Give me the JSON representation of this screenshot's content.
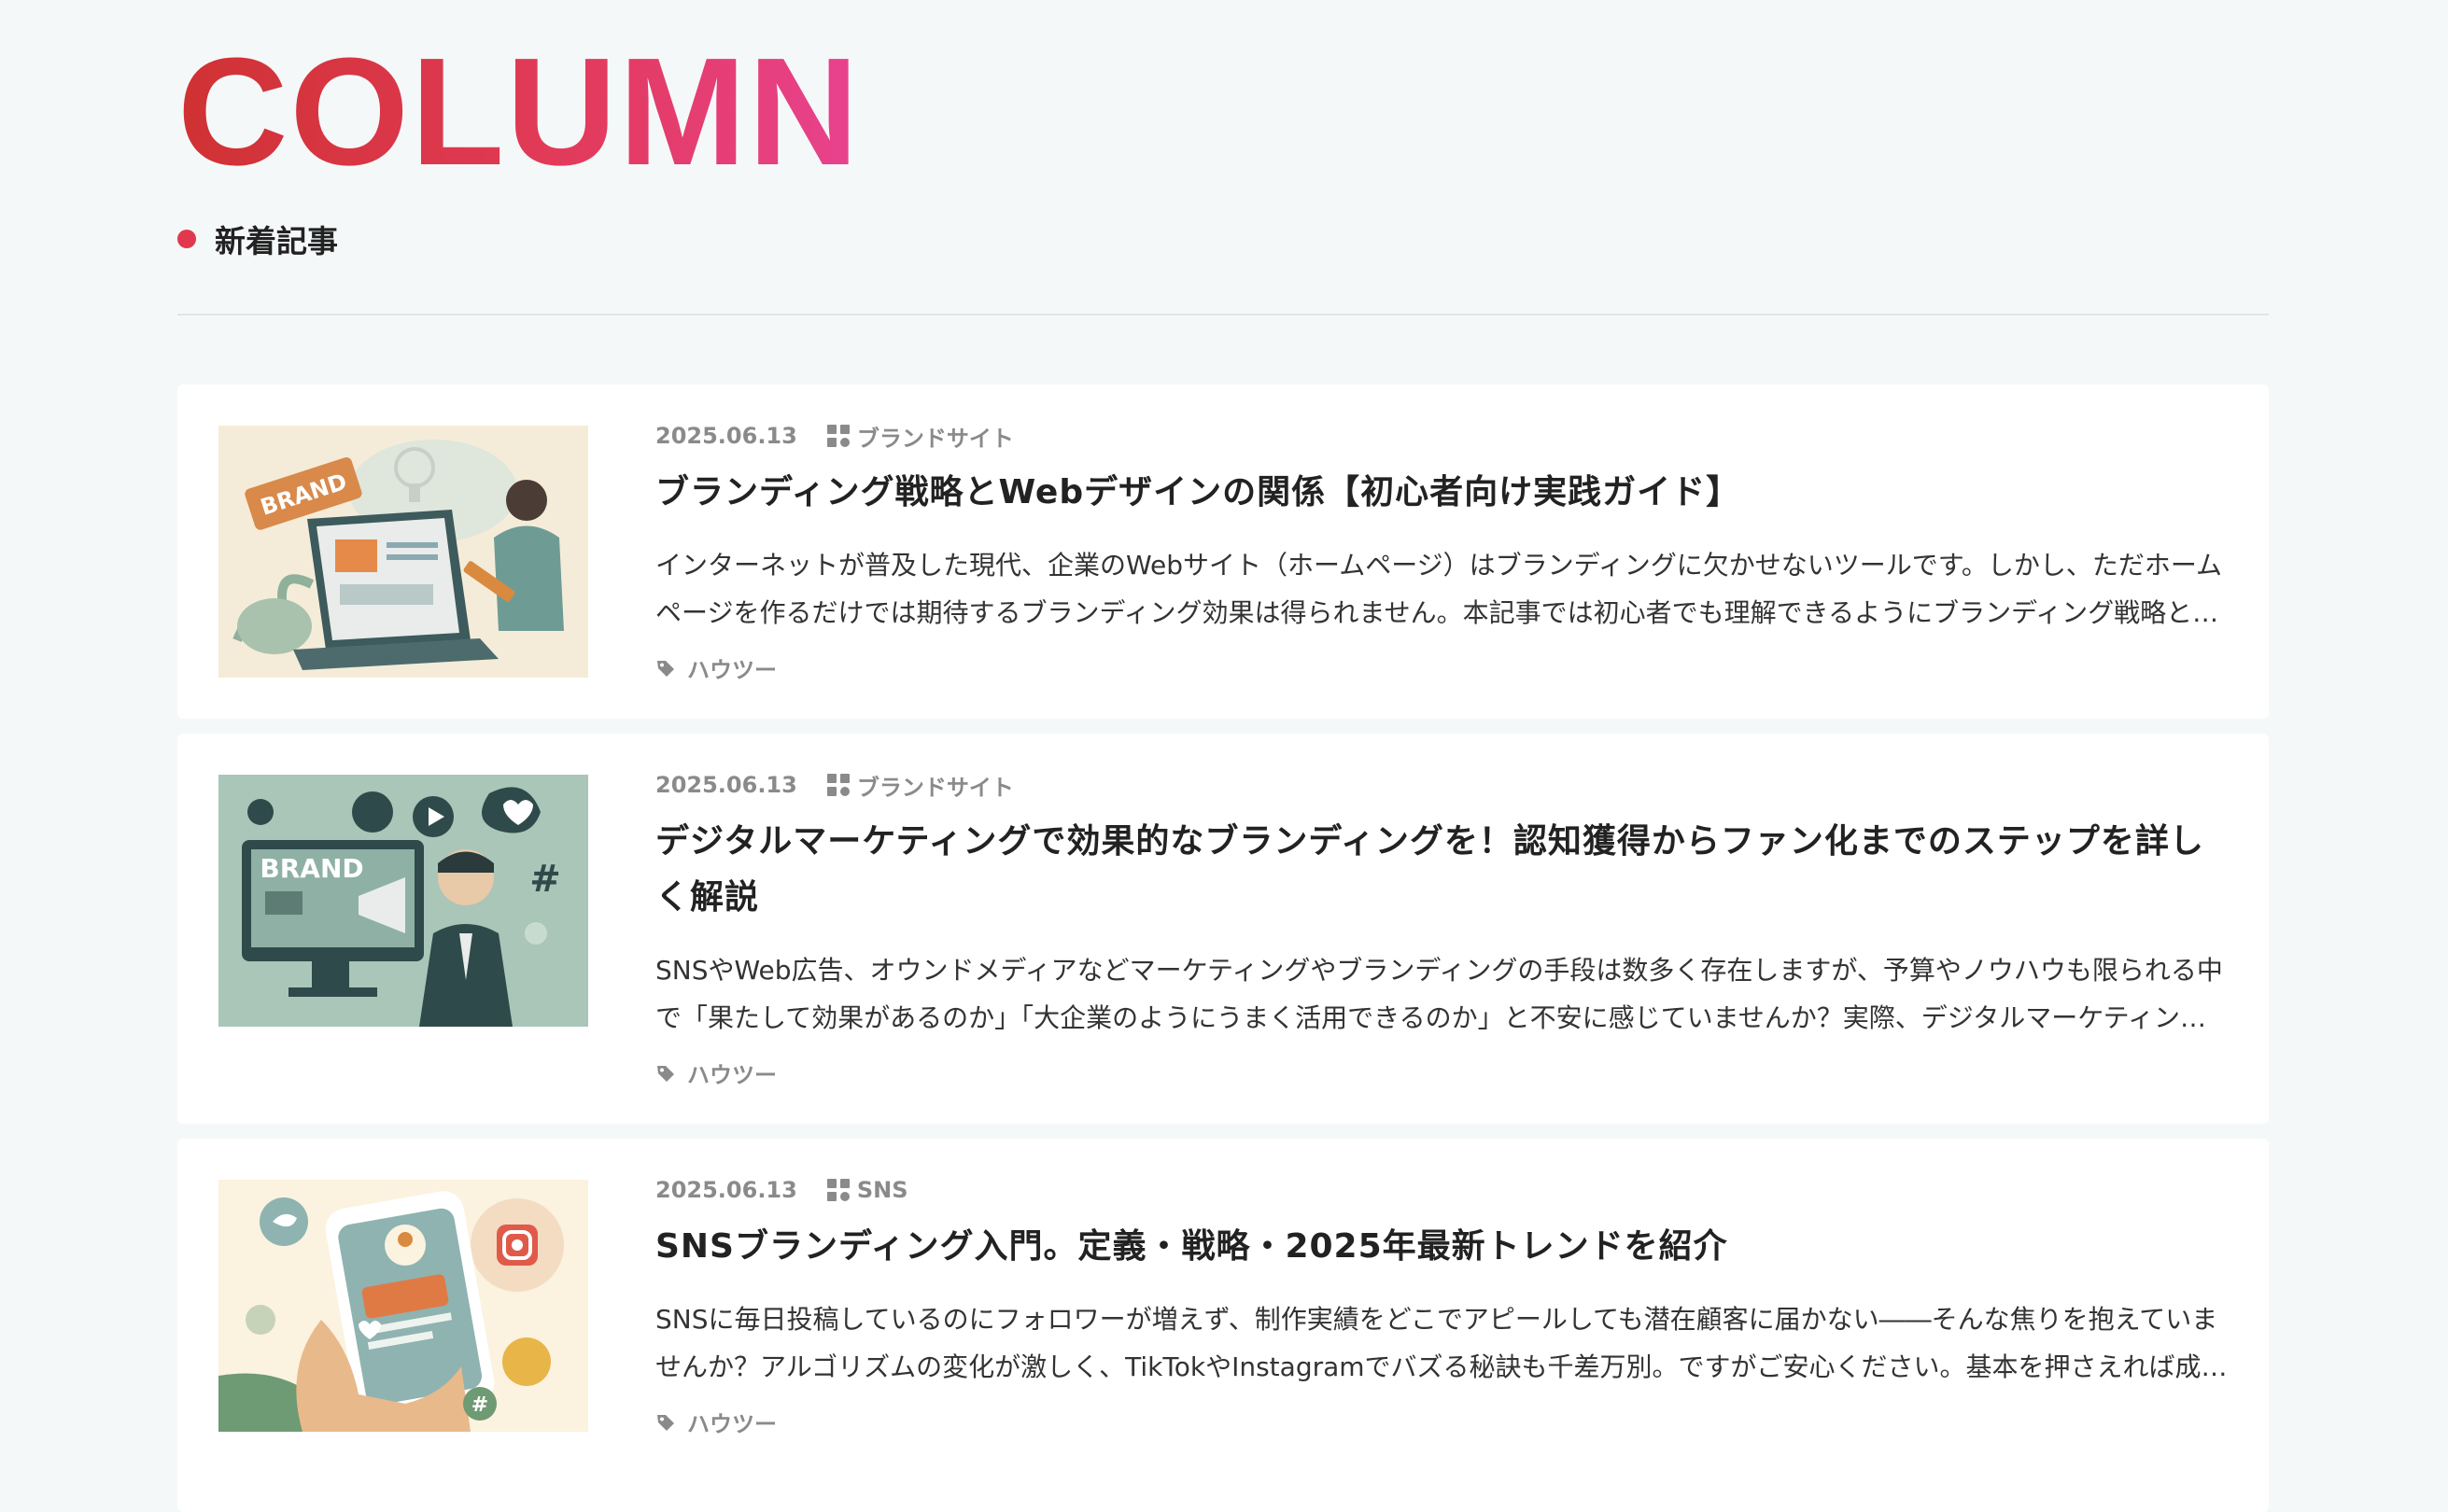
{
  "header": {
    "title": "COLUMN",
    "subtitle": "新着記事"
  },
  "colors": {
    "accent_dot": "#e2384d",
    "title_gradient_start": "#cf3233",
    "title_gradient_end": "#e8428f"
  },
  "articles": [
    {
      "date": "2025.06.13",
      "category": "ブランドサイト",
      "title": "ブランディング戦略とWebデザインの関係【初心者向け実践ガイド】",
      "excerpt": "インターネットが普及した現代、企業のWebサイト（ホームページ）はブランディングに欠かせないツールです。しかし、ただホームページを作るだけでは期待するブランディング効果は得られません。本記事では初心者でも理解できるようにブランディング戦略とWebデザインの関係を解説します。",
      "tag": "ハウツー",
      "thumb_label": "BRAND"
    },
    {
      "date": "2025.06.13",
      "category": "ブランドサイト",
      "title": "デジタルマーケティングで効果的なブランディングを！認知獲得からファン化までのステップを詳しく解説",
      "excerpt": "SNSやWeb広告、オウンドメディアなどマーケティングやブランディングの手段は数多く存在しますが、予算やノウハウも限られる中で「果たして効果があるのか」「大企業のようにうまく活用できるのか」と不安に感じていませんか？実際、デジタルマーケティングを活用したブランディングは多くの企業で成果を上げています。",
      "tag": "ハウツー",
      "thumb_label": "BRAND"
    },
    {
      "date": "2025.06.13",
      "category": "SNS",
      "title": "SNSブランディング入門。定義・戦略・2025年最新トレンドを紹介",
      "excerpt": "SNSに毎日投稿しているのにフォロワーが増えず、制作実績をどこでアピールしても潜在顧客に届かない――そんな焦りを抱えていませんか？アルゴリズムの変化が激しく、TikTokやInstagramでバズる秘訣も千差万別。ですがご安心ください。基本を押さえれば成果は必ず出ます。",
      "tag": "ハウツー",
      "thumb_label": "#"
    }
  ]
}
